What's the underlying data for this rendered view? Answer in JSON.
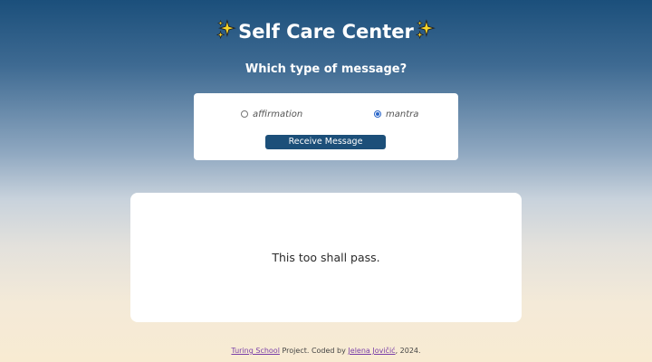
{
  "header": {
    "title": "Self Care Center",
    "sparkle_icon": "sparkles-emoji",
    "subtitle": "Which type of message?"
  },
  "form": {
    "options": [
      {
        "label": "affirmation",
        "selected": false
      },
      {
        "label": "mantra",
        "selected": true
      }
    ],
    "button_label": "Receive Message"
  },
  "message": {
    "text": "This too shall pass."
  },
  "footer": {
    "link_school": "Turing School",
    "text_project": " Project. Coded by ",
    "link_author": "Jelena Jovičić",
    "text_year": ", 2024."
  },
  "colors": {
    "accent": "#1c4f79",
    "radio": "#2a66c9",
    "link": "#7a3fa8"
  }
}
